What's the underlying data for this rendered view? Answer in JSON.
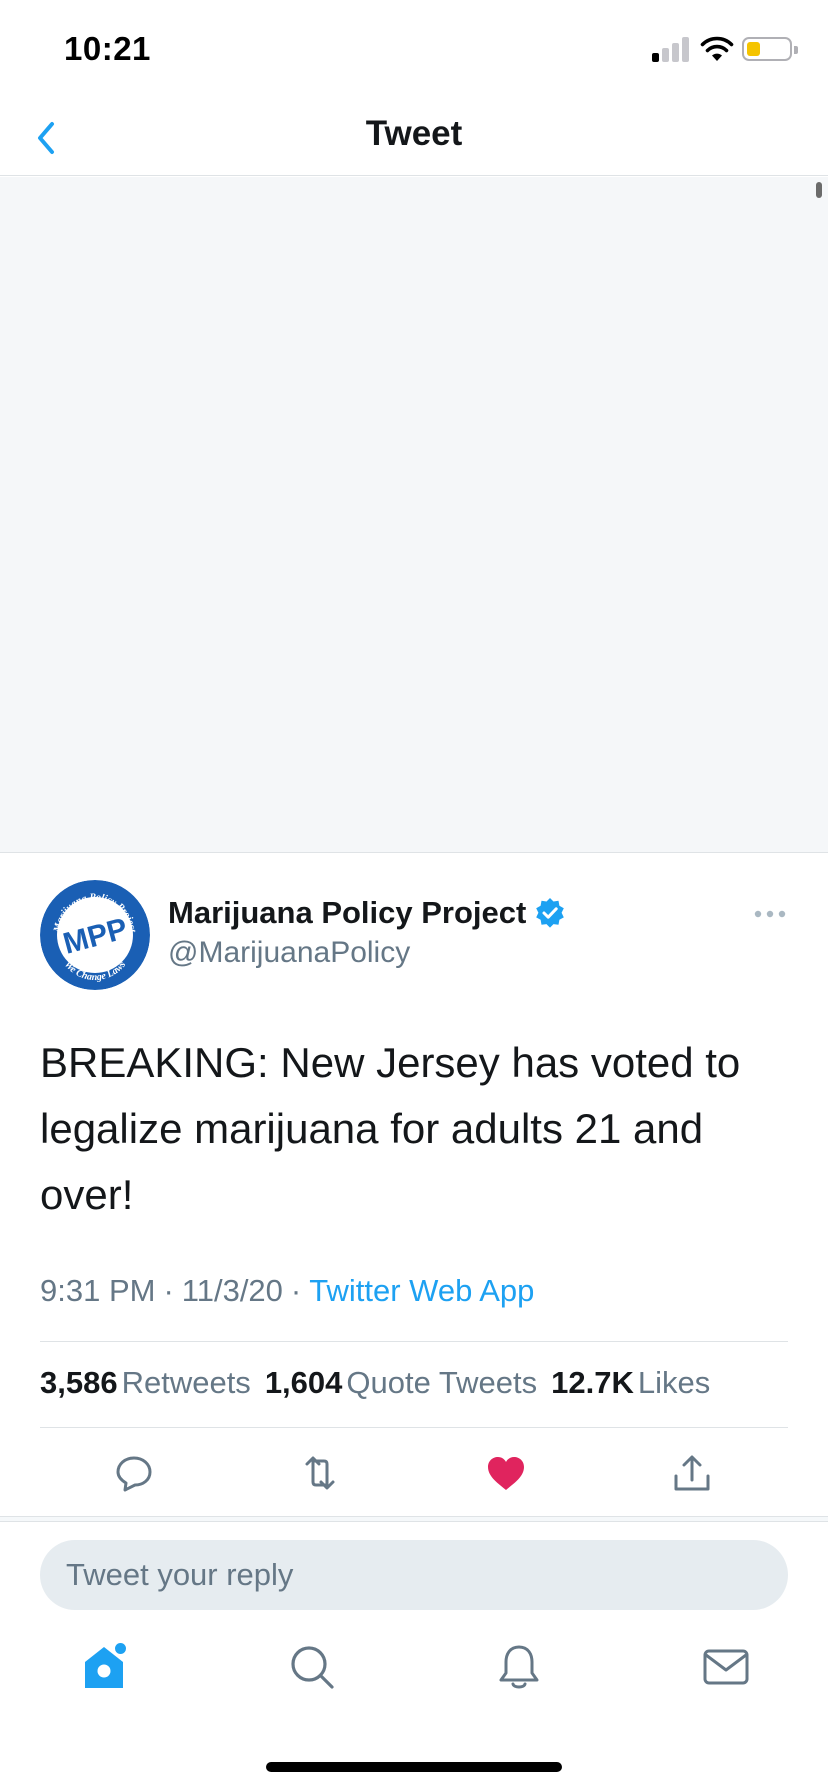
{
  "status_bar": {
    "time": "10:21"
  },
  "header": {
    "title": "Tweet"
  },
  "author": {
    "name": "Marijuana Policy Project",
    "handle": "@MarijuanaPolicy",
    "verified": true,
    "avatar": {
      "initials": "MPP",
      "ring_top_text": "Marijuana Policy Project",
      "ring_bottom_text": "We Change Laws",
      "color": "#1a5fb4"
    }
  },
  "tweet": {
    "text": "BREAKING: New Jersey has voted to legalize marijuana for adults 21 and over!",
    "time": "9:31 PM",
    "date": "11/3/20",
    "separator": "·",
    "source": "Twitter Web App"
  },
  "stats": [
    {
      "value": "3,586",
      "label": "Retweets"
    },
    {
      "value": "1,604",
      "label": "Quote Tweets"
    },
    {
      "value": "12.7K",
      "label": "Likes"
    }
  ],
  "actions": {
    "liked": true,
    "icons": [
      "reply-icon",
      "retweet-icon",
      "like-icon",
      "share-icon"
    ]
  },
  "reply": {
    "placeholder": "Tweet your reply"
  },
  "tabs": [
    "home-icon",
    "search-icon",
    "notifications-icon",
    "messages-icon"
  ],
  "colors": {
    "accent": "#1da1f2",
    "like": "#e0245e",
    "text_primary": "#14171a",
    "text_secondary": "#657786"
  }
}
